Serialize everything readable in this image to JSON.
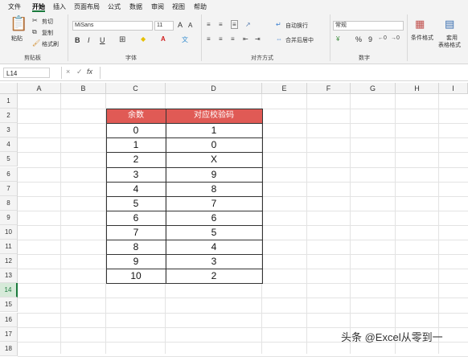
{
  "menu": {
    "tabs": [
      "文件",
      "开始",
      "插入",
      "页面布局",
      "公式",
      "数据",
      "审阅",
      "视图",
      "帮助"
    ],
    "active_tab": "开始"
  },
  "ribbon": {
    "clipboard": {
      "paste_label": "粘贴",
      "cut_label": "剪切",
      "copy_label": "复制",
      "format_painter_label": "格式刷",
      "group_label": "剪贴板"
    },
    "font": {
      "font_name": "MiSans",
      "font_size": "11",
      "bold": "B",
      "italic": "I",
      "underline": "U",
      "increase_size": "A",
      "decrease_size": "A",
      "group_label": "字体"
    },
    "alignment": {
      "wrap_text_label": "自动换行",
      "merge_label": "合并后居中",
      "group_label": "对齐方式"
    },
    "number": {
      "format": "常规",
      "percent": "%",
      "comma": "9",
      "group_label": "数字"
    },
    "styles": {
      "conditional_label": "条件格式",
      "table_format_label": "套用表格格式",
      "table_format_label_line1": "套用",
      "table_format_label_line2": "表格格式"
    }
  },
  "formula_bar": {
    "name_box": "L14",
    "cancel_icon": "×",
    "confirm_icon": "✓",
    "fx_label": "fx"
  },
  "sheet": {
    "columns": [
      "A",
      "B",
      "C",
      "D",
      "E",
      "F",
      "G",
      "H",
      "I"
    ],
    "rows": [
      "1",
      "2",
      "3",
      "4",
      "5",
      "6",
      "7",
      "8",
      "9",
      "10",
      "11",
      "12",
      "13",
      "14",
      "15",
      "16",
      "17",
      "18"
    ],
    "selected_row": "14",
    "header_color": "#e05a55",
    "table": {
      "headers": [
        "余数",
        "对应校验码"
      ],
      "rows": [
        [
          "0",
          "1"
        ],
        [
          "1",
          "0"
        ],
        [
          "2",
          "X"
        ],
        [
          "3",
          "9"
        ],
        [
          "4",
          "8"
        ],
        [
          "5",
          "7"
        ],
        [
          "6",
          "6"
        ],
        [
          "7",
          "5"
        ],
        [
          "8",
          "4"
        ],
        [
          "9",
          "3"
        ],
        [
          "10",
          "2"
        ]
      ]
    }
  },
  "watermark": "头条 @Excel从零到一"
}
